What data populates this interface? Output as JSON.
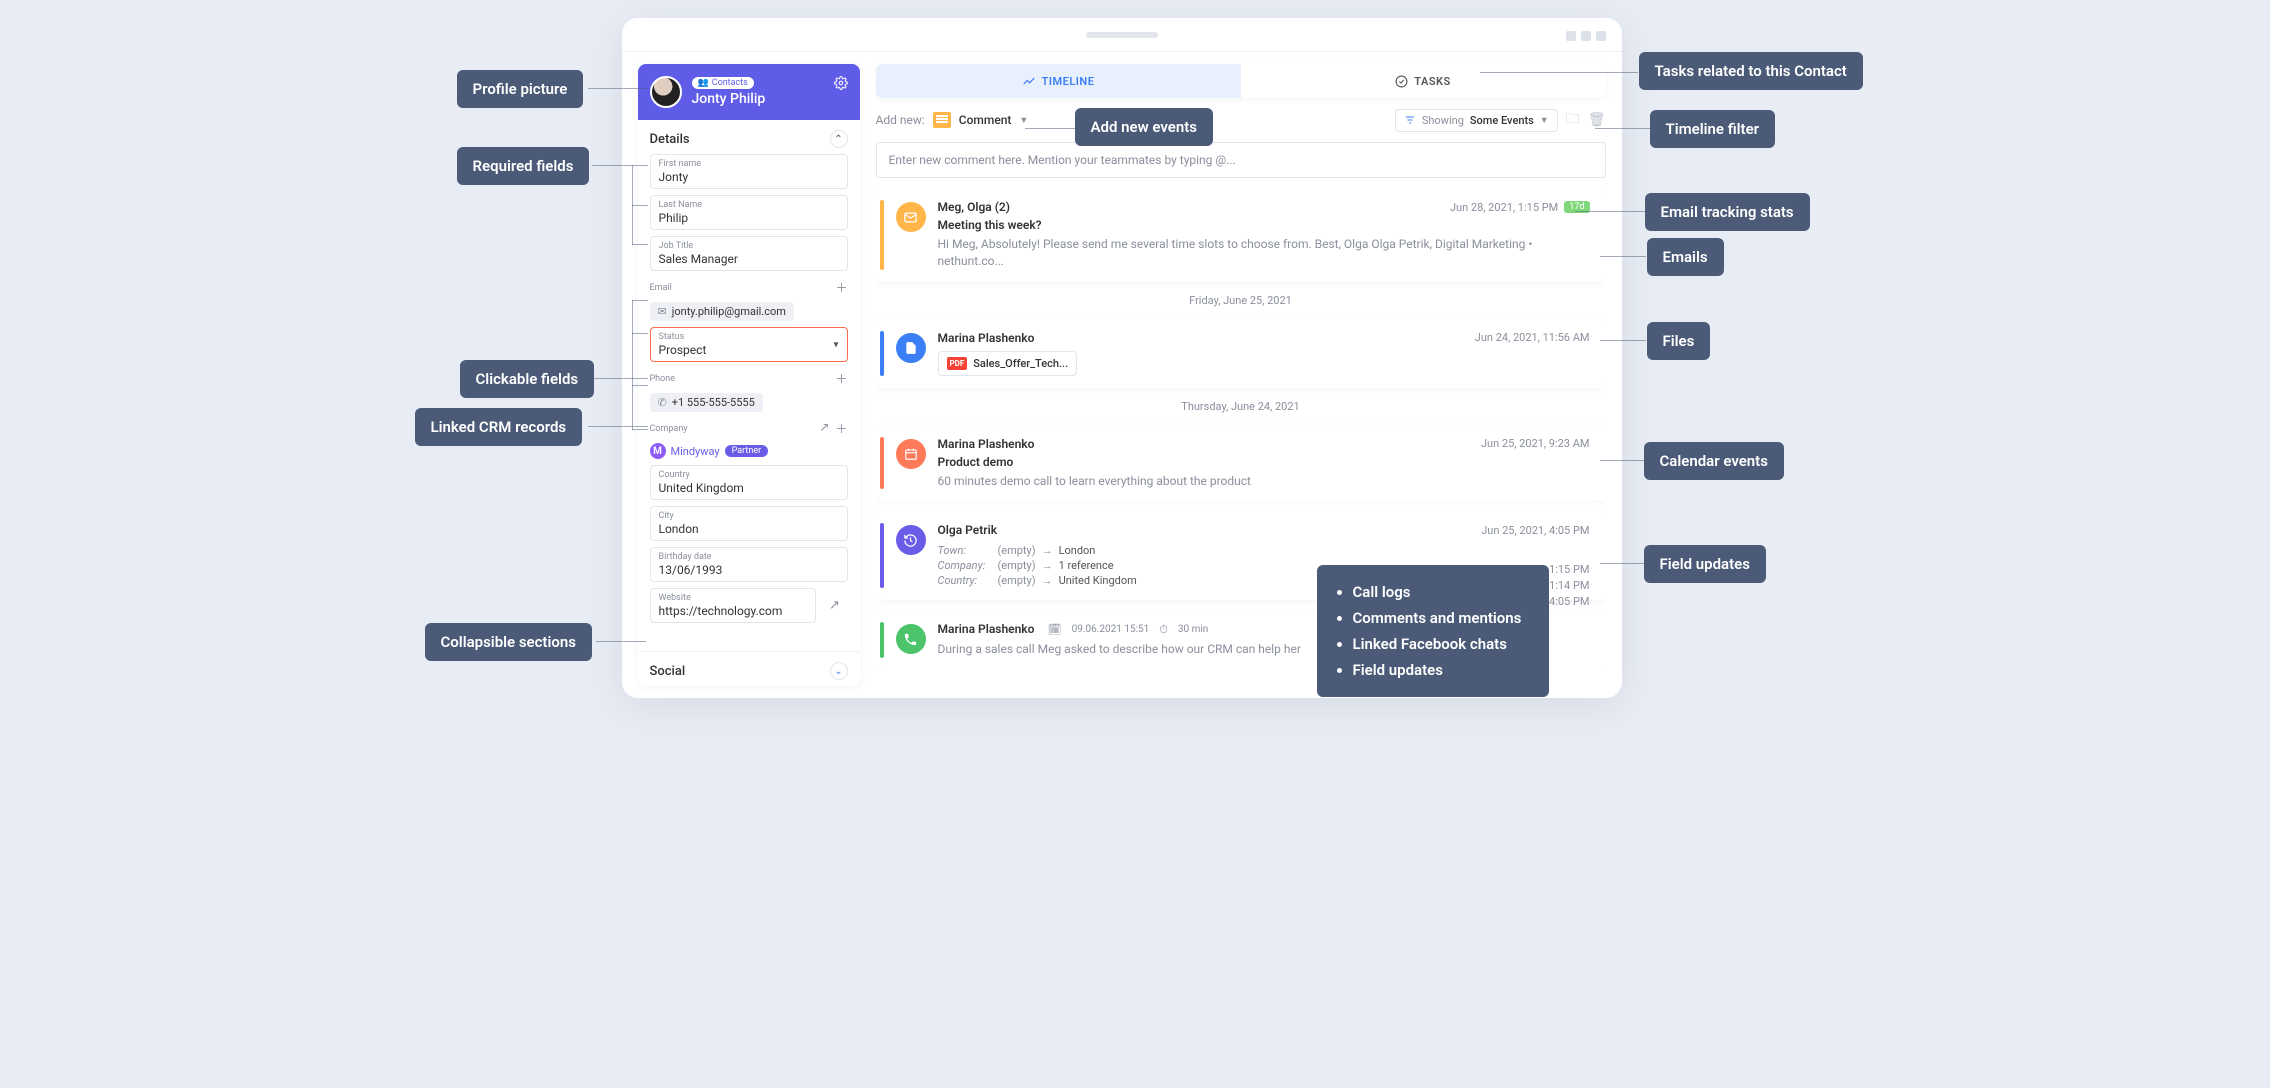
{
  "header": {
    "contacts_label": "Contacts",
    "full_name": "Jonty Philip"
  },
  "sections": {
    "details": "Details",
    "social": "Social"
  },
  "fields": {
    "first_name": {
      "label": "First name",
      "value": "Jonty"
    },
    "last_name": {
      "label": "Last Name",
      "value": "Philip"
    },
    "job_title": {
      "label": "Job Title",
      "value": "Sales Manager"
    },
    "email": {
      "label": "Email",
      "value": "jonty.philip@gmail.com"
    },
    "status": {
      "label": "Status",
      "value": "Prospect"
    },
    "phone": {
      "label": "Phone",
      "value": "+1 555-555-5555"
    },
    "company": {
      "label": "Company",
      "badge": "M",
      "name": "Mindyway",
      "tag": "Partner"
    },
    "country": {
      "label": "Country",
      "value": "United Kingdom"
    },
    "city": {
      "label": "City",
      "value": "London"
    },
    "birthday": {
      "label": "Birthday date",
      "value": "13/06/1993"
    },
    "website": {
      "label": "Website",
      "value": "https://technology.com"
    }
  },
  "tabs": {
    "timeline": "TIMELINE",
    "tasks": "TASKS"
  },
  "toolbar": {
    "add_new": "Add new:",
    "comment": "Comment",
    "filter_showing": "Showing",
    "filter_value": "Some Events"
  },
  "input": {
    "placeholder": "Enter new comment here. Mention your teammates by typing @..."
  },
  "timeline": {
    "email1": {
      "from": "Meg, Olga (2)",
      "subject": "Meeting this week?",
      "snippet": "Hi Meg, Absolutely! Please send me several time slots to choose from. Best, Olga Olga Petrik, Digital Marketing • nethunt.co...",
      "time": "Jun 28, 2021, 1:15 PM",
      "views": "17d"
    },
    "sep1": "Friday, June 25, 2021",
    "file1": {
      "author": "Marina Plashenko",
      "time": "Jun 24, 2021, 11:56 AM",
      "filename": "Sales_Offer_Tech..."
    },
    "sep2": "Thursday, June 24, 2021",
    "cal1": {
      "author": "Marina Plashenko",
      "time": "Jun 25, 2021, 9:23 AM",
      "title": "Product demo",
      "desc": "60 minutes demo call to learn everything about the product"
    },
    "upd1": {
      "author": "Olga Petrik",
      "time": "Jun 25, 2021, 4:05 PM",
      "t1": "1:15 PM",
      "t2": "1:14 PM",
      "t3": "4:05 PM",
      "r1": {
        "field": "Town:",
        "from": "(empty)",
        "to": "London"
      },
      "r2": {
        "field": "Company:",
        "from": "(empty)",
        "to": "1 reference"
      },
      "r3": {
        "field": "Country:",
        "from": "(empty)",
        "to": "United Kingdom"
      }
    },
    "call1": {
      "author": "Marina Plashenko",
      "date": "09.06.2021 15:51",
      "duration": "30 min",
      "note": "During a sales call Meg asked to describe how our CRM can help her"
    }
  },
  "callouts": {
    "profile_pic": "Profile picture",
    "required": "Required fields",
    "clickable": "Clickable fields",
    "linked": "Linked CRM records",
    "collapsible": "Collapsible sections",
    "add_new": "Add new events",
    "timeline_filter": "Timeline filter",
    "tasks_related": "Tasks related to this Contact",
    "email_stats": "Email tracking stats",
    "emails": "Emails",
    "files": "Files",
    "calendar": "Calendar events",
    "field_updates": "Field updates",
    "list": {
      "i1": "Call logs",
      "i2": "Comments and mentions",
      "i3": "Linked Facebook chats",
      "i4": "Field updates"
    }
  }
}
